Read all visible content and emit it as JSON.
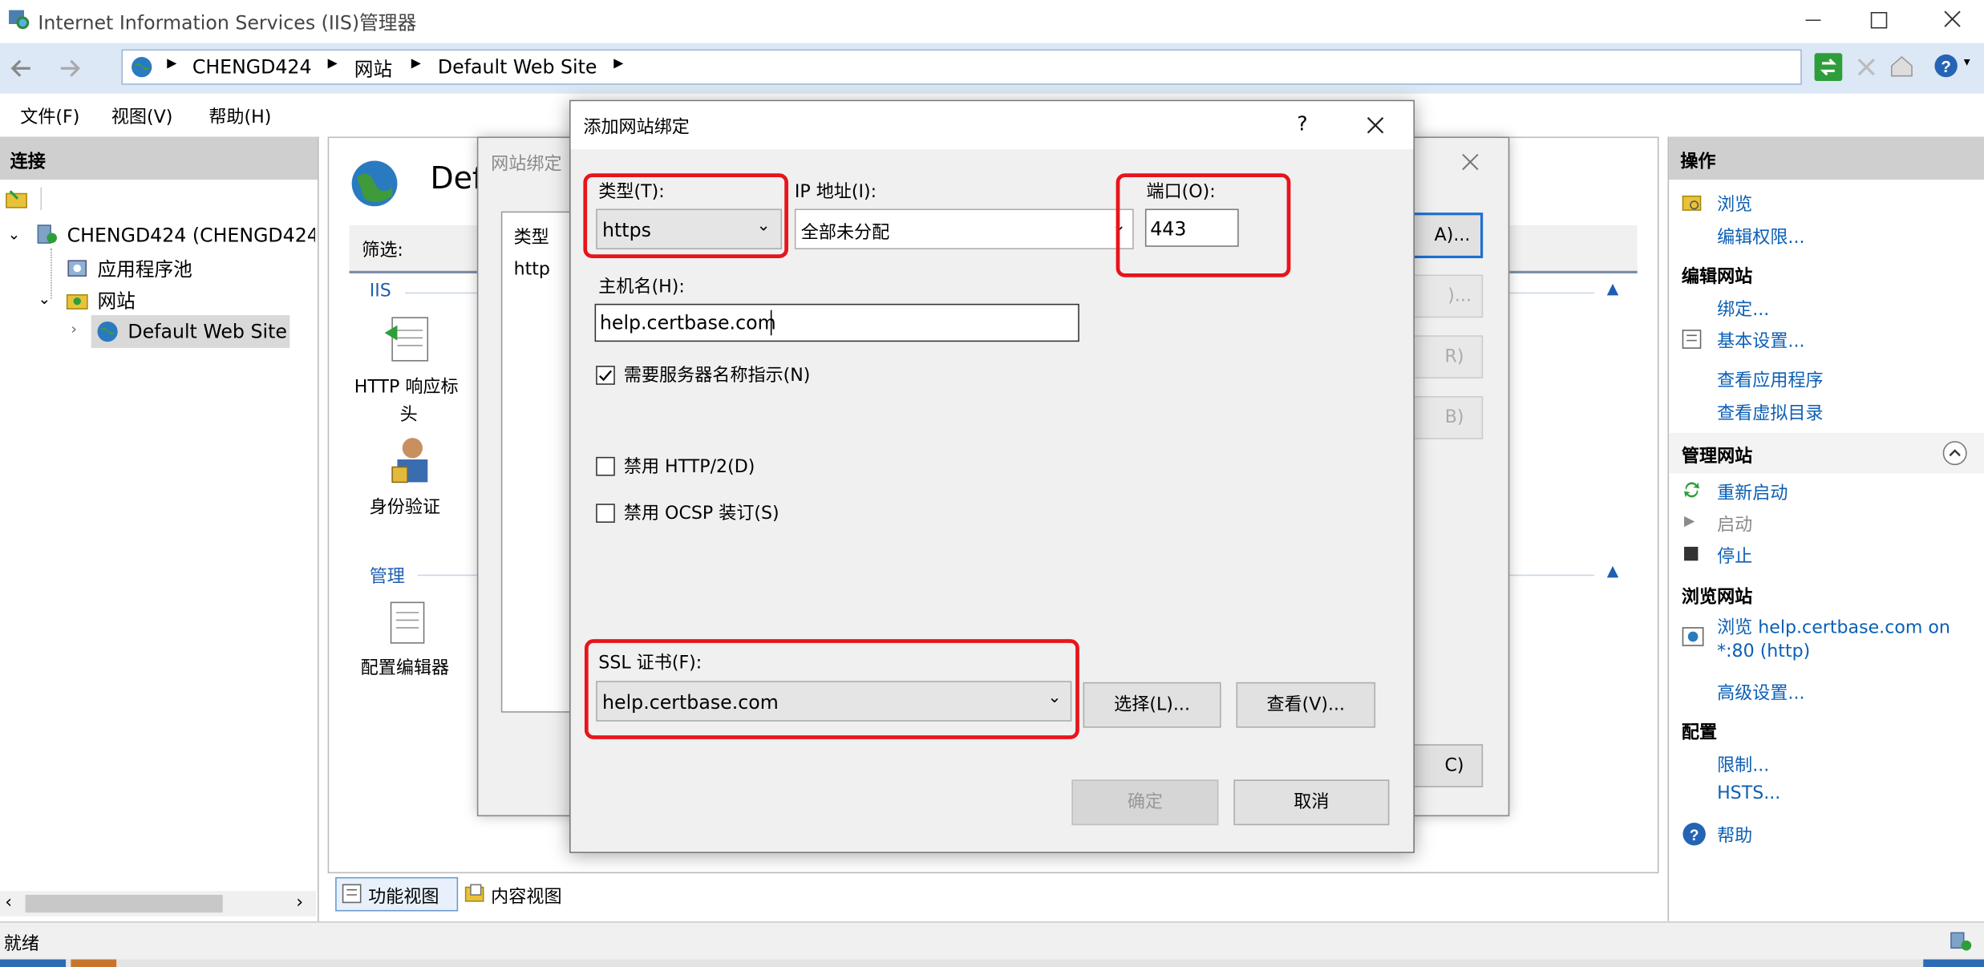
{
  "window": {
    "title": "Internet Information Services (IIS)管理器"
  },
  "addressbar": {
    "crumbs": [
      "CHENGD424",
      "网站",
      "Default Web Site"
    ]
  },
  "menu": {
    "file": "文件(F)",
    "view": "视图(V)",
    "help": "帮助(H)"
  },
  "connections": {
    "title": "连接",
    "server": "CHENGD424 (CHENGD424\\",
    "app_pools": "应用程序池",
    "sites": "网站",
    "default_site": "Default Web Site"
  },
  "center": {
    "page_title": "Def",
    "filter_label": "筛选:",
    "group_iis": "IIS",
    "http_headers_line1": "HTTP 响应标",
    "http_headers_line2": "头",
    "auth": "身份验证",
    "group_mgmt": "管理",
    "config_editor": "配置编辑器"
  },
  "bindings_dialog": {
    "title": "网站绑定",
    "col_type": "类型",
    "row_type": "http",
    "btn_add_partial": "A)...",
    "btn_edit_partial": ")...",
    "btn_remove_partial": "R)",
    "btn_browse_partial": "B)",
    "btn_close_partial": "C)"
  },
  "add_binding": {
    "title": "添加网站绑定",
    "help": "?",
    "type_label": "类型(T):",
    "type_value": "https",
    "ip_label": "IP 地址(I):",
    "ip_value": "全部未分配",
    "port_label": "端口(O):",
    "port_value": "443",
    "host_label": "主机名(H):",
    "host_value": "help.certbase.com",
    "sni_label": "需要服务器名称指示(N)",
    "sni_checked": true,
    "http2_label": "禁用 HTTP/2(D)",
    "http2_checked": false,
    "ocsp_label": "禁用 OCSP 装订(S)",
    "ocsp_checked": false,
    "ssl_label": "SSL 证书(F):",
    "ssl_value": "help.certbase.com",
    "select_btn": "选择(L)...",
    "view_btn": "查看(V)...",
    "ok_btn": "确定",
    "cancel_btn": "取消"
  },
  "actions": {
    "title": "操作",
    "browse": "浏览",
    "edit_perms": "编辑权限...",
    "edit_site_header": "编辑网站",
    "bindings": "绑定...",
    "basic_settings": "基本设置...",
    "view_apps": "查看应用程序",
    "view_vdirs": "查看虚拟目录",
    "manage_site_header": "管理网站",
    "restart": "重新启动",
    "start": "启动",
    "stop": "停止",
    "browse_site_header": "浏览网站",
    "browse_link_line1": "浏览 help.certbase.com on",
    "browse_link_line2": "*:80 (http)",
    "advanced": "高级设置...",
    "config_header": "配置",
    "limits": "限制...",
    "hsts": "HSTS...",
    "help": "帮助"
  },
  "bottom_tabs": {
    "features": "功能视图",
    "content": "内容视图"
  },
  "status": {
    "text": "就绪"
  },
  "colors": {
    "accent_red": "#e8141c",
    "link_blue": "#0b5fb5",
    "panel_header": "#cfcfcf"
  }
}
